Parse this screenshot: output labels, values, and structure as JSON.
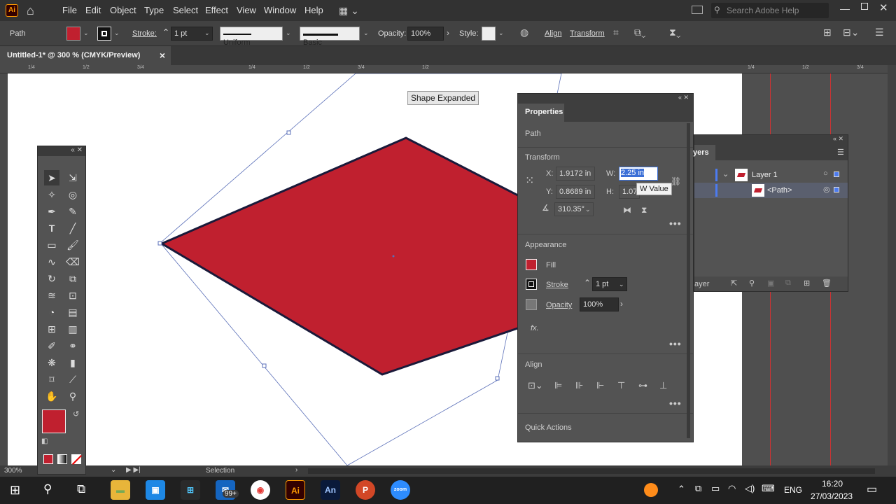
{
  "app": {
    "logo": "Ai",
    "title": "Adobe Illustrator"
  },
  "menu": [
    "File",
    "Edit",
    "Object",
    "Type",
    "Select",
    "Effect",
    "View",
    "Window",
    "Help"
  ],
  "search": {
    "placeholder": "Search Adobe Help"
  },
  "control_bar": {
    "selection_label": "Path",
    "fill_color": "#c0202f",
    "stroke_label": "Stroke:",
    "stroke_value": "1 pt",
    "profile_uniform": "Uniform",
    "brush_basic": "Basic",
    "opacity_label": "Opacity:",
    "opacity_value": "100%",
    "style_label": "Style:",
    "align_label": "Align",
    "transform_label": "Transform"
  },
  "document_tab": {
    "title": "Untitled-1* @ 300 % (CMYK/Preview)",
    "close": "×"
  },
  "ruler_marks": [
    "1/4",
    "1/2",
    "3/4",
    "1/4",
    "1/2",
    "3/4",
    "1/2",
    "1/4",
    "1/2",
    "3/4",
    "1/4",
    "1/2",
    "3/4",
    "1/4"
  ],
  "canvas": {
    "tooltip": "Shape Expanded",
    "shape_color": "#c0202f",
    "stroke_color": "#1a1a3a"
  },
  "status": {
    "zoom": "300%",
    "tool": "Selection"
  },
  "properties_panel": {
    "tab": "Properties",
    "object_type": "Path",
    "transform_title": "Transform",
    "x_label": "X:",
    "x_value": "1.9172 in",
    "y_label": "Y:",
    "y_value": "0.8689 in",
    "w_label": "W:",
    "w_value": "2.25 in",
    "h_label": "H:",
    "h_value": "1.07",
    "angle_value": "310.35°",
    "w_tooltip": "W Value",
    "appearance_title": "Appearance",
    "fill_label": "Fill",
    "stroke_label": "Stroke",
    "stroke_value": "1 pt",
    "opacity_label": "Opacity",
    "opacity_value": "100%",
    "fx_label": "fx.",
    "align_title": "Align",
    "quick_actions_title": "Quick Actions"
  },
  "layers_panel": {
    "tab": "yers",
    "layer_name": "Layer 1",
    "sublayer_name": "<Path>",
    "footer_label": "ayer"
  },
  "taskbar": {
    "mail_badge": "99+",
    "lang": "ENG",
    "time": "16:20",
    "date": "27/03/2023",
    "apps": [
      "Ai",
      "An",
      "P",
      "zoom"
    ]
  }
}
